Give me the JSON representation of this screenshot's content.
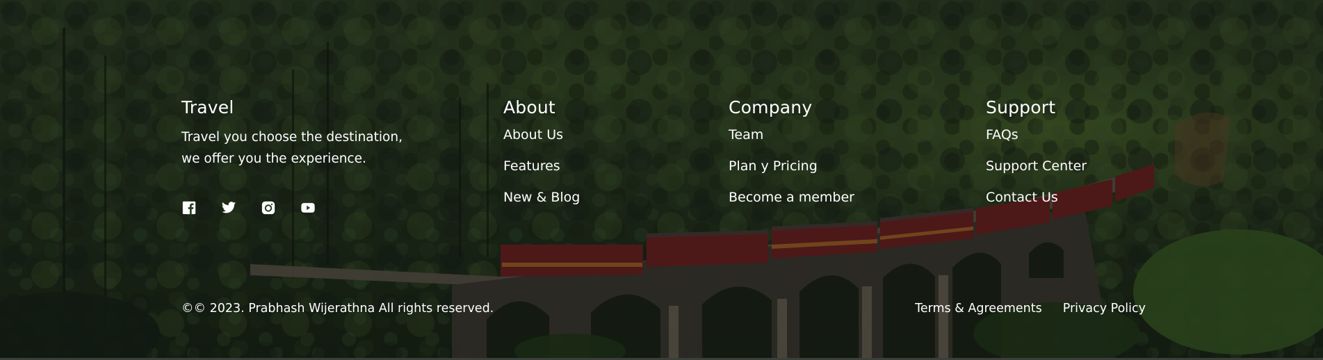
{
  "brand": {
    "title": "Travel",
    "tagline_line1": "Travel you choose the destination,",
    "tagline_line2": "we offer you the experience."
  },
  "socials": [
    {
      "icon": "facebook-icon"
    },
    {
      "icon": "twitter-icon"
    },
    {
      "icon": "instagram-icon"
    },
    {
      "icon": "youtube-icon"
    }
  ],
  "columns": {
    "about": {
      "title": "About",
      "links": [
        "About Us",
        "Features",
        "New & Blog"
      ]
    },
    "company": {
      "title": "Company",
      "links": [
        "Team",
        "Plan y Pricing",
        "Become a member"
      ]
    },
    "support": {
      "title": "Support",
      "links": [
        "FAQs",
        "Support Center",
        "Contact Us"
      ]
    }
  },
  "bottom": {
    "copyright": "©© 2023. Prabhash Wijerathna All rights reserved.",
    "legal_links": [
      "Terms & Agreements",
      "Privacy Policy"
    ]
  },
  "colors": {
    "text": "#ffffff",
    "background_forest": "#24341f"
  }
}
